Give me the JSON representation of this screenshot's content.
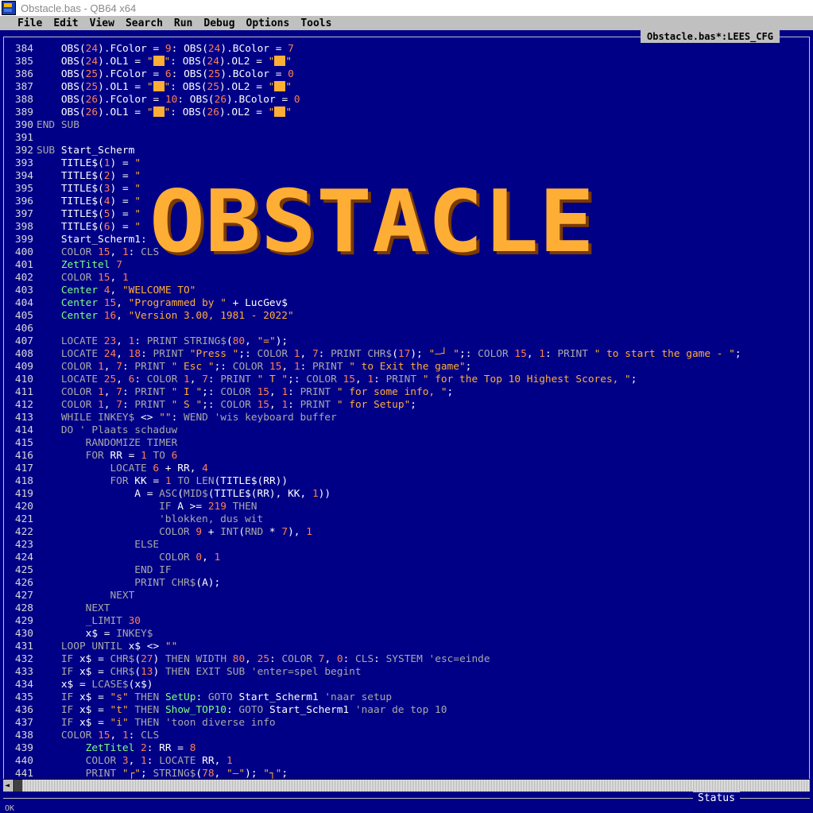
{
  "window": {
    "title": "Obstacle.bas - QB64 x64"
  },
  "menu": [
    "File",
    "Edit",
    "View",
    "Search",
    "Run",
    "Debug",
    "Options",
    "Tools"
  ],
  "editor": {
    "file_tab": "Obstacle.bas*:LEES_CFG",
    "banner_text": "OBSTACLE",
    "lines": [
      {
        "n": "384",
        "code": "OBS(24).FColor = 9: OBS(24).BColor = 7"
      },
      {
        "n": "385",
        "code": "OBS(24).OL1 = \"▒\": OBS(24).OL2 = \"▒\""
      },
      {
        "n": "386",
        "code": "OBS(25).FColor = 6: OBS(25).BColor = 0"
      },
      {
        "n": "387",
        "code": "OBS(25).OL1 = \"█\": OBS(25).OL2 = \"█\""
      },
      {
        "n": "388",
        "code": "OBS(26).FColor = 10: OBS(26).BColor = 0"
      },
      {
        "n": "389",
        "code": "OBS(26).OL1 = \"█\": OBS(26).OL2 = \"█\""
      },
      {
        "n": "390",
        "code": "END SUB"
      },
      {
        "n": "391",
        "code": ""
      },
      {
        "n": "392",
        "code": "SUB Start_Scherm"
      },
      {
        "n": "393",
        "code": "TITLE$(1) = \""
      },
      {
        "n": "394",
        "code": "TITLE$(2) = \""
      },
      {
        "n": "395",
        "code": "TITLE$(3) = \""
      },
      {
        "n": "396",
        "code": "TITLE$(4) = \""
      },
      {
        "n": "397",
        "code": "TITLE$(5) = \""
      },
      {
        "n": "398",
        "code": "TITLE$(6) = \""
      },
      {
        "n": "399",
        "code": "Start_Scherm1:"
      },
      {
        "n": "400",
        "code": "COLOR 15, 1: CLS"
      },
      {
        "n": "401",
        "code": "ZetTitel 7"
      },
      {
        "n": "402",
        "code": "COLOR 15, 1"
      },
      {
        "n": "403",
        "code": "Center 4, \"WELCOME TO\""
      },
      {
        "n": "404",
        "code": "Center 15, \"Programmed by \" + LucGev$"
      },
      {
        "n": "405",
        "code": "Center 16, \"Version 3.00, 1981 - 2022\""
      },
      {
        "n": "406",
        "code": ""
      },
      {
        "n": "407",
        "code": "LOCATE 23, 1: PRINT STRING$(80, \"=\");"
      },
      {
        "n": "408",
        "code": "LOCATE 24, 18: PRINT \"Press \";: COLOR 1, 7: PRINT CHR$(17); \"—┘ \";: COLOR 15, 1: PRINT \" to start the game - \";"
      },
      {
        "n": "409",
        "code": "COLOR 1, 7: PRINT \" Esc \";: COLOR 15, 1: PRINT \" to Exit the game\";"
      },
      {
        "n": "410",
        "code": "LOCATE 25, 6: COLOR 1, 7: PRINT \" T \";: COLOR 15, 1: PRINT \" for the Top 10 Highest Scores, \";"
      },
      {
        "n": "411",
        "code": "COLOR 1, 7: PRINT \" I \";: COLOR 15, 1: PRINT \" for some info, \";"
      },
      {
        "n": "412",
        "code": "COLOR 1, 7: PRINT \" S \";: COLOR 15, 1: PRINT \" for Setup\";"
      },
      {
        "n": "413",
        "code": "WHILE INKEY$ <> \"\": WEND 'wis keyboard buffer"
      },
      {
        "n": "414",
        "code": "DO ' Plaats schaduw"
      },
      {
        "n": "415",
        "code": "RANDOMIZE TIMER"
      },
      {
        "n": "416",
        "code": "FOR RR = 1 TO 6"
      },
      {
        "n": "417",
        "code": "LOCATE 6 + RR, 4"
      },
      {
        "n": "418",
        "code": "FOR KK = 1 TO LEN(TITLE$(RR))"
      },
      {
        "n": "419",
        "code": "A = ASC(MID$(TITLE$(RR), KK, 1))"
      },
      {
        "n": "420",
        "code": "IF A >= 219 THEN"
      },
      {
        "n": "421",
        "code": "'blokken, dus wit"
      },
      {
        "n": "422",
        "code": "COLOR 9 + INT(RND * 7), 1"
      },
      {
        "n": "423",
        "code": "ELSE"
      },
      {
        "n": "424",
        "code": "COLOR 0, 1"
      },
      {
        "n": "425",
        "code": "END IF"
      },
      {
        "n": "426",
        "code": "PRINT CHR$(A);"
      },
      {
        "n": "427",
        "code": "NEXT"
      },
      {
        "n": "428",
        "code": "NEXT"
      },
      {
        "n": "429",
        "code": "_LIMIT 30"
      },
      {
        "n": "430",
        "code": "x$ = INKEY$"
      },
      {
        "n": "431",
        "code": "LOOP UNTIL x$ <> \"\""
      },
      {
        "n": "432",
        "code": "IF x$ = CHR$(27) THEN WIDTH 80, 25: COLOR 7, 0: CLS: SYSTEM 'esc=einde"
      },
      {
        "n": "433",
        "code": "IF x$ = CHR$(13) THEN EXIT SUB 'enter=spel begint"
      },
      {
        "n": "434",
        "code": "x$ = LCASE$(x$)"
      },
      {
        "n": "435",
        "code": "IF x$ = \"s\" THEN SetUp: GOTO Start_Scherm1 'naar setup"
      },
      {
        "n": "436",
        "code": "IF x$ = \"t\" THEN Show_TOP10: GOTO Start_Scherm1 'naar de top 10"
      },
      {
        "n": "437",
        "code": "IF x$ = \"i\" THEN 'toon diverse info"
      },
      {
        "n": "438",
        "code": "COLOR 15, 1: CLS"
      },
      {
        "n": "439",
        "code": "ZetTitel 2: RR = 8"
      },
      {
        "n": "440",
        "code": "COLOR 3, 1: LOCATE RR, 1"
      },
      {
        "n": "441",
        "code": "PRINT \"┌\"; STRING$(78, \"—\"); \"┐\";"
      }
    ]
  },
  "status": {
    "label": "Status",
    "text": "OK"
  },
  "colors": {
    "background": "#000087",
    "string": "#ffae35",
    "number": "#ff7f50",
    "sub_name": "#7fff7f"
  }
}
